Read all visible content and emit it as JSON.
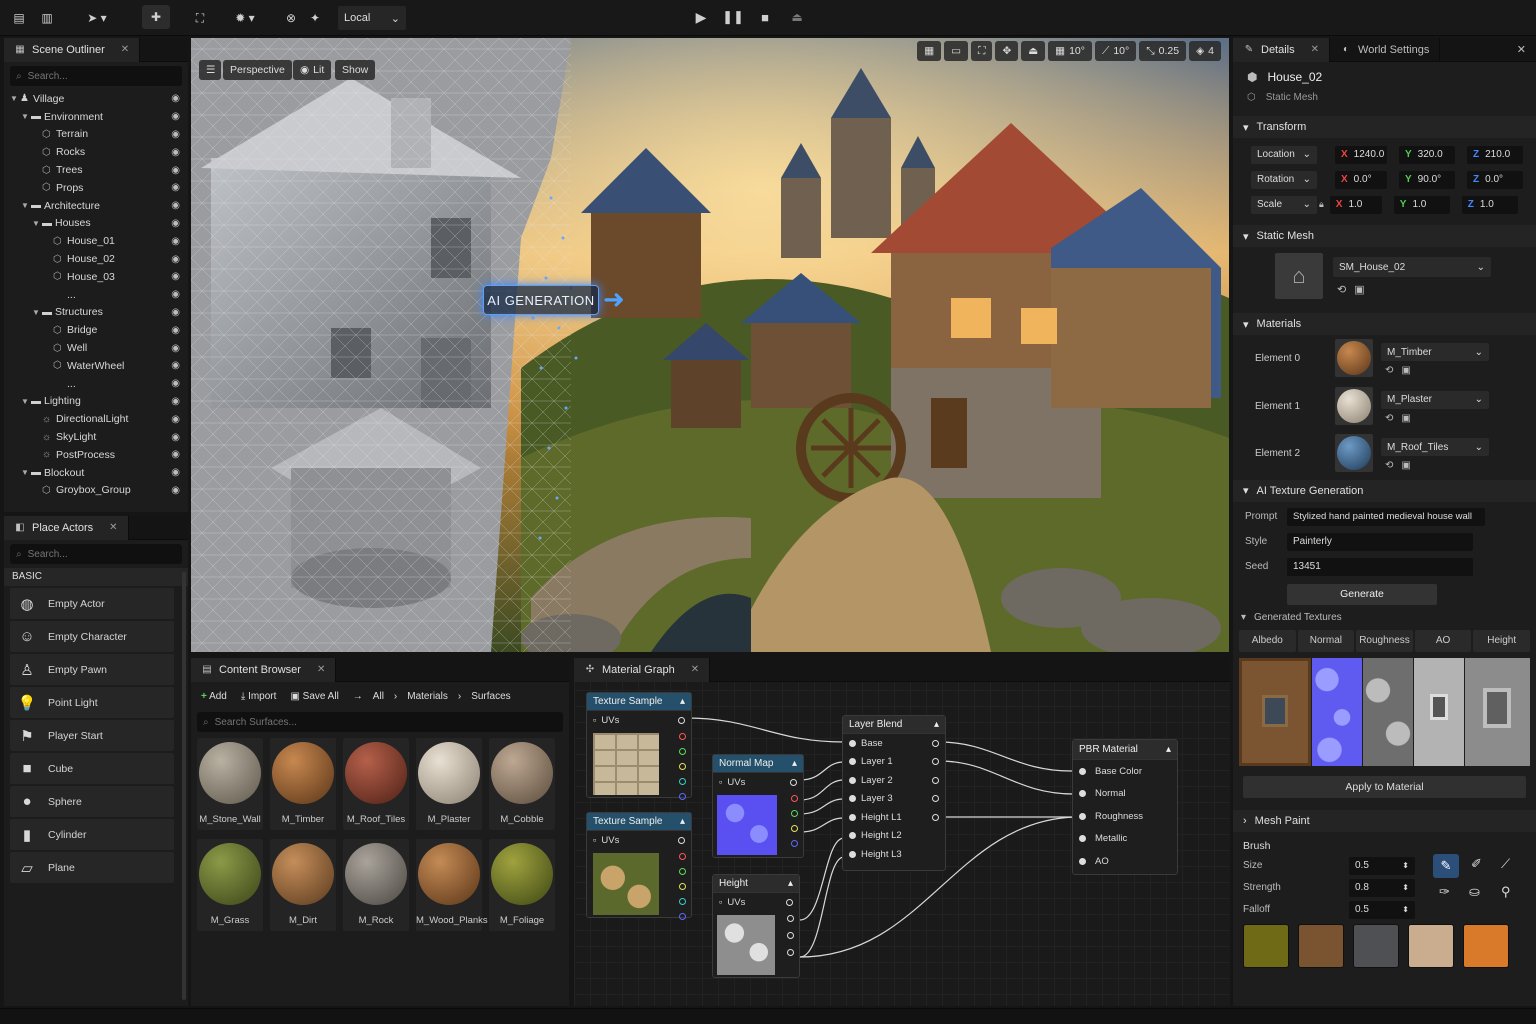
{
  "toolbar": {
    "space_mode": "Local",
    "play_label": "play",
    "pause_label": "pause",
    "stop_label": "stop"
  },
  "outliner": {
    "tab": "Scene Outliner",
    "search_placeholder": "Search...",
    "items": [
      {
        "label": "Village",
        "depth": 0,
        "type": "root",
        "expand": true
      },
      {
        "label": "Environment",
        "depth": 1,
        "type": "folder",
        "expand": true
      },
      {
        "label": "Terrain",
        "depth": 2,
        "type": "mesh"
      },
      {
        "label": "Rocks",
        "depth": 2,
        "type": "mesh"
      },
      {
        "label": "Trees",
        "depth": 2,
        "type": "mesh"
      },
      {
        "label": "Props",
        "depth": 2,
        "type": "mesh"
      },
      {
        "label": "Architecture",
        "depth": 1,
        "type": "folder",
        "expand": true
      },
      {
        "label": "Houses",
        "depth": 2,
        "type": "folder",
        "expand": true
      },
      {
        "label": "House_01",
        "depth": 3,
        "type": "mesh"
      },
      {
        "label": "House_02",
        "depth": 3,
        "type": "mesh"
      },
      {
        "label": "House_03",
        "depth": 3,
        "type": "mesh"
      },
      {
        "label": "...",
        "depth": 3,
        "type": "more"
      },
      {
        "label": "Structures",
        "depth": 2,
        "type": "folder",
        "expand": true
      },
      {
        "label": "Bridge",
        "depth": 3,
        "type": "mesh"
      },
      {
        "label": "Well",
        "depth": 3,
        "type": "mesh"
      },
      {
        "label": "WaterWheel",
        "depth": 3,
        "type": "mesh"
      },
      {
        "label": "...",
        "depth": 3,
        "type": "more"
      },
      {
        "label": "Lighting",
        "depth": 1,
        "type": "folder",
        "expand": true
      },
      {
        "label": "DirectionalLight",
        "depth": 2,
        "type": "light"
      },
      {
        "label": "SkyLight",
        "depth": 2,
        "type": "light"
      },
      {
        "label": "PostProcess",
        "depth": 2,
        "type": "light"
      },
      {
        "label": "Blockout",
        "depth": 1,
        "type": "folder",
        "expand": true
      },
      {
        "label": "Groybox_Group",
        "depth": 2,
        "type": "mesh"
      }
    ]
  },
  "place_actors": {
    "tab": "Place Actors",
    "search_placeholder": "Search...",
    "category": "BASIC",
    "items": [
      "Empty Actor",
      "Empty Character",
      "Empty Pawn",
      "Point Light",
      "Player Start",
      "Cube",
      "Sphere",
      "Cylinder",
      "Plane"
    ]
  },
  "viewport": {
    "perspective": "Perspective",
    "lit": "Lit",
    "show": "Show",
    "grid_snap": "10°",
    "rot_snap": "10°",
    "scale_snap": "0.25",
    "camera_speed": "4",
    "ai_label": "AI GENERATION"
  },
  "content_browser": {
    "tab": "Content Browser",
    "add": "Add",
    "import": "Import",
    "save_all": "Save All",
    "breadcrumb": [
      "All",
      "Materials",
      "Surfaces"
    ],
    "search_placeholder": "Search Surfaces...",
    "materials": [
      {
        "name": "M_Stone_Wall",
        "c1": "#b9b1a2",
        "c2": "#5e574b"
      },
      {
        "name": "M_Timber",
        "c1": "#c7884f",
        "c2": "#5a3518"
      },
      {
        "name": "M_Roof_Tiles",
        "c1": "#b5604a",
        "c2": "#4e2016"
      },
      {
        "name": "M_Plaster",
        "c1": "#e8e0d2",
        "c2": "#8a8072"
      },
      {
        "name": "M_Cobble",
        "c1": "#bda892",
        "c2": "#5b4b3c"
      },
      {
        "name": "M_Grass",
        "c1": "#8b9a48",
        "c2": "#3b4418"
      },
      {
        "name": "M_Dirt",
        "c1": "#c58e5a",
        "c2": "#5a3a1e"
      },
      {
        "name": "M_Rock",
        "c1": "#a9a39b",
        "c2": "#4a4641"
      },
      {
        "name": "M_Wood_Planks",
        "c1": "#c48b55",
        "c2": "#5a3417"
      },
      {
        "name": "M_Foliage",
        "c1": "#a0a23e",
        "c2": "#3d4714"
      }
    ]
  },
  "material_graph": {
    "tab": "Material Graph",
    "tex1": {
      "title": "Texture Sample",
      "pin": "UVs"
    },
    "tex2": {
      "title": "Texture Sample",
      "pin": "UVs"
    },
    "normal": {
      "title": "Normal Map",
      "pin": "UVs"
    },
    "height": {
      "title": "Height",
      "pin": "UVs"
    },
    "blend": {
      "title": "Layer Blend",
      "pins": [
        "Base",
        "Layer 1",
        "Layer 2",
        "Layer 3",
        "Height L1",
        "Height L2",
        "Height L3"
      ]
    },
    "pbr": {
      "title": "PBR Material",
      "pins": [
        "Base Color",
        "Normal",
        "Roughness",
        "Metallic",
        "AO"
      ]
    }
  },
  "details": {
    "tab": "Details",
    "tab2": "World Settings",
    "object_name": "House_02",
    "object_type": "Static Mesh",
    "transform_label": "Transform",
    "transform": [
      {
        "label": "Location",
        "x": "1240.0",
        "y": "320.0",
        "z": "210.0"
      },
      {
        "label": "Rotation",
        "x": "0.0°",
        "y": "90.0°",
        "z": "0.0°"
      },
      {
        "label": "Scale",
        "x": "1.0",
        "y": "1.0",
        "z": "1.0"
      }
    ],
    "static_mesh_label": "Static Mesh",
    "static_mesh": "SM_House_02",
    "materials_label": "Materials",
    "materials": [
      {
        "element": "Element 0",
        "value": "M_Timber",
        "c1": "#c7884f",
        "c2": "#5a3518"
      },
      {
        "element": "Element 1",
        "value": "M_Plaster",
        "c1": "#e8e0d2",
        "c2": "#8a8072"
      },
      {
        "element": "Element 2",
        "value": "M_Roof_Tiles",
        "c1": "#6d9ac4",
        "c2": "#1e3a58"
      }
    ],
    "ai_label": "AI Texture Generation",
    "prompt_label": "Prompt",
    "prompt": "Stylized hand painted medieval house wall",
    "style_label": "Style",
    "style": "Painterly",
    "seed_label": "Seed",
    "seed": "13451",
    "generate": "Generate",
    "generated_label": "Generated Textures",
    "tex_tabs": [
      "Albedo",
      "Normal",
      "Roughness",
      "AO",
      "Height"
    ],
    "apply": "Apply to Material",
    "mesh_paint": "Mesh Paint",
    "brush": "Brush",
    "size_label": "Size",
    "size": "0.5",
    "strength_label": "Strength",
    "strength": "0.8",
    "falloff_label": "Falloff",
    "falloff": "0.5",
    "swatches": [
      "#6e6a16",
      "#7a5430",
      "#4f5054",
      "#c9ad8e",
      "#d87a2a"
    ]
  }
}
